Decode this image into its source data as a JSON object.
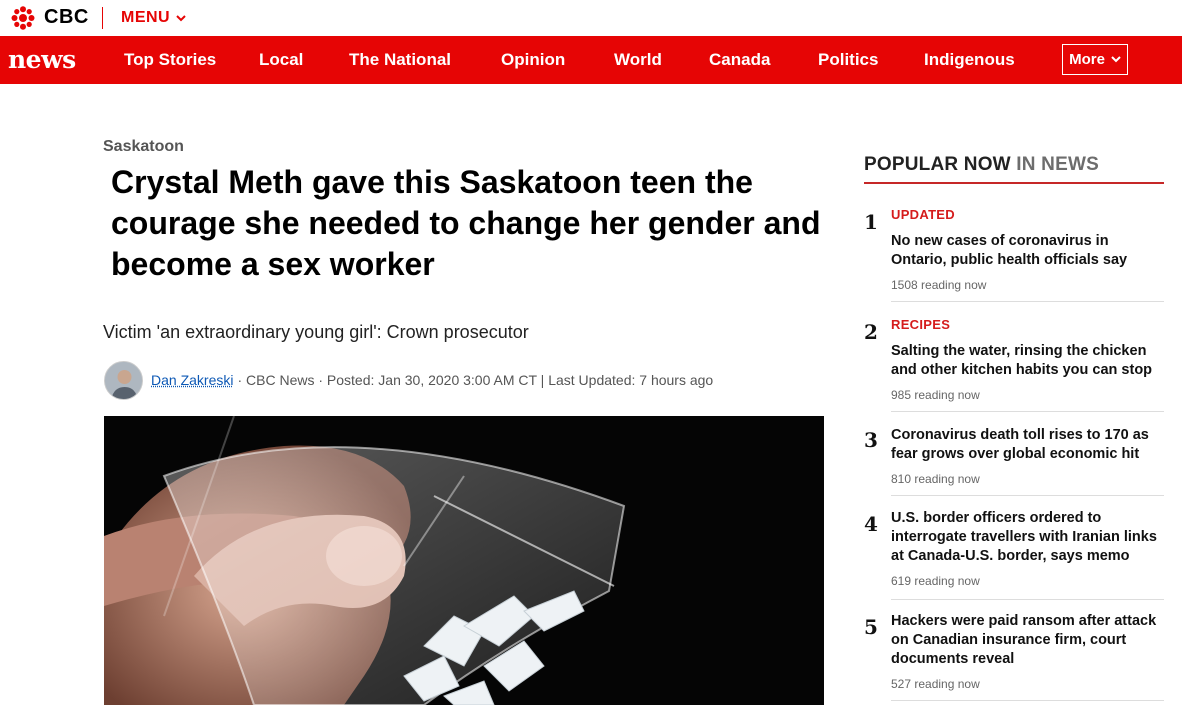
{
  "brand": {
    "name": "CBC",
    "menu_label": "MENU",
    "accent": "#e60505"
  },
  "nav": {
    "brand": "news",
    "items": [
      {
        "label": "Top Stories"
      },
      {
        "label": "Local"
      },
      {
        "label": "The National"
      },
      {
        "label": "Opinion"
      },
      {
        "label": "World"
      },
      {
        "label": "Canada"
      },
      {
        "label": "Politics"
      },
      {
        "label": "Indigenous"
      }
    ],
    "more_label": "More"
  },
  "article": {
    "section": "Saskatoon",
    "headline": "Crystal Meth gave this Saskatoon teen the courage she needed to change her gender and become a sex worker",
    "deck": "Victim 'an extraordinary young girl': Crown prosecutor",
    "author": "Dan Zakreski",
    "meta": "· CBC News · Posted: Jan 30, 2020 3:00 AM CT | Last Updated: 7 hours ago"
  },
  "popular": {
    "title_main": "POPULAR NOW",
    "title_suffix": "IN NEWS",
    "items": [
      {
        "rank": "1",
        "kicker": "UPDATED",
        "headline": "No new cases of coronavirus in Ontario, public health officials say",
        "reading": "1508 reading now"
      },
      {
        "rank": "2",
        "kicker": "RECIPES",
        "headline": "Salting the water, rinsing the chicken and other kitchen habits you can stop",
        "reading": "985 reading now"
      },
      {
        "rank": "3",
        "kicker": "",
        "headline": "Coronavirus death toll rises to 170 as fear grows over global economic hit",
        "reading": "810 reading now"
      },
      {
        "rank": "4",
        "kicker": "",
        "headline": "U.S. border officers ordered to interrogate travellers with Iranian links at Canada-U.S. border, says memo",
        "reading": "619 reading now"
      },
      {
        "rank": "5",
        "kicker": "",
        "headline": "Hackers were paid ransom after attack on Canadian insurance firm, court documents reveal",
        "reading": "527 reading now"
      }
    ]
  }
}
